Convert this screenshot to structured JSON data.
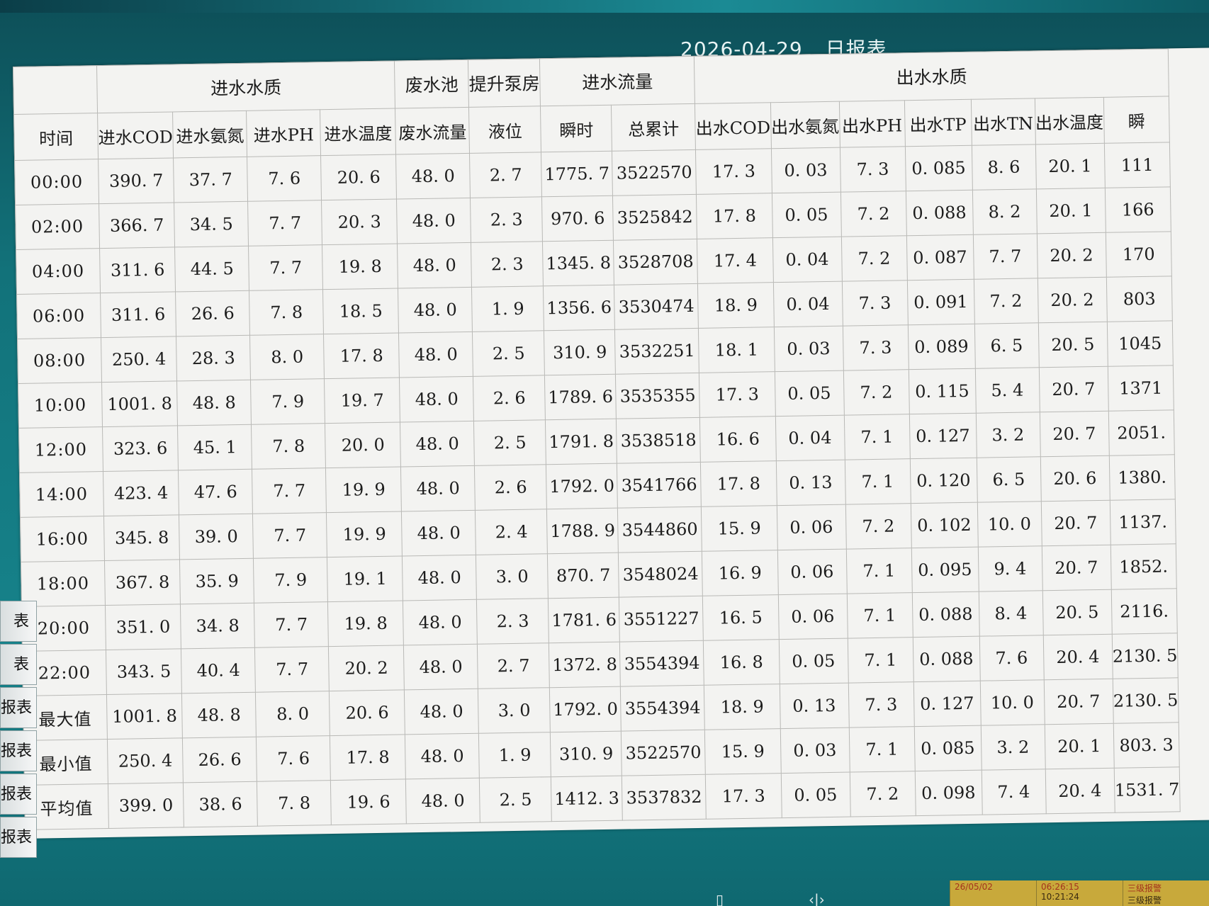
{
  "report": {
    "date": "2026-04-29",
    "title": "日报表"
  },
  "table": {
    "groups": {
      "time_blank": "",
      "inflow_quality": "进水水质",
      "waste_pool": "废水池",
      "lift_pump": "提升泵房",
      "inflow_rate": "进水流量",
      "outflow_quality": "出水水质"
    },
    "columns": [
      "时间",
      "进水COD",
      "进水氨氮",
      "进水PH",
      "进水温度",
      "废水流量",
      "液位",
      "瞬时",
      "总累计",
      "出水COD",
      "出水氨氮",
      "出水PH",
      "出水TP",
      "出水TN",
      "出水温度",
      "瞬"
    ],
    "rows": [
      [
        "00:00",
        "390. 7",
        "37. 7",
        "7. 6",
        "20. 6",
        "48. 0",
        "2. 7",
        "1775. 7",
        "3522570",
        "17. 3",
        "0. 03",
        "7. 3",
        "0. 085",
        "8. 6",
        "20. 1",
        "111"
      ],
      [
        "02:00",
        "366. 7",
        "34. 5",
        "7. 7",
        "20. 3",
        "48. 0",
        "2. 3",
        "970. 6",
        "3525842",
        "17. 8",
        "0. 05",
        "7. 2",
        "0. 088",
        "8. 2",
        "20. 1",
        "166"
      ],
      [
        "04:00",
        "311. 6",
        "44. 5",
        "7. 7",
        "19. 8",
        "48. 0",
        "2. 3",
        "1345. 8",
        "3528708",
        "17. 4",
        "0. 04",
        "7. 2",
        "0. 087",
        "7. 7",
        "20. 2",
        "170"
      ],
      [
        "06:00",
        "311. 6",
        "26. 6",
        "7. 8",
        "18. 5",
        "48. 0",
        "1. 9",
        "1356. 6",
        "3530474",
        "18. 9",
        "0. 04",
        "7. 3",
        "0. 091",
        "7. 2",
        "20. 2",
        "803"
      ],
      [
        "08:00",
        "250. 4",
        "28. 3",
        "8. 0",
        "17. 8",
        "48. 0",
        "2. 5",
        "310. 9",
        "3532251",
        "18. 1",
        "0. 03",
        "7. 3",
        "0. 089",
        "6. 5",
        "20. 5",
        "1045"
      ],
      [
        "10:00",
        "1001. 8",
        "48. 8",
        "7. 9",
        "19. 7",
        "48. 0",
        "2. 6",
        "1789. 6",
        "3535355",
        "17. 3",
        "0. 05",
        "7. 2",
        "0. 115",
        "5. 4",
        "20. 7",
        "1371"
      ],
      [
        "12:00",
        "323. 6",
        "45. 1",
        "7. 8",
        "20. 0",
        "48. 0",
        "2. 5",
        "1791. 8",
        "3538518",
        "16. 6",
        "0. 04",
        "7. 1",
        "0. 127",
        "3. 2",
        "20. 7",
        "2051."
      ],
      [
        "14:00",
        "423. 4",
        "47. 6",
        "7. 7",
        "19. 9",
        "48. 0",
        "2. 6",
        "1792. 0",
        "3541766",
        "17. 8",
        "0. 13",
        "7. 1",
        "0. 120",
        "6. 5",
        "20. 6",
        "1380."
      ],
      [
        "16:00",
        "345. 8",
        "39. 0",
        "7. 7",
        "19. 9",
        "48. 0",
        "2. 4",
        "1788. 9",
        "3544860",
        "15. 9",
        "0. 06",
        "7. 2",
        "0. 102",
        "10. 0",
        "20. 7",
        "1137."
      ],
      [
        "18:00",
        "367. 8",
        "35. 9",
        "7. 9",
        "19. 1",
        "48. 0",
        "3. 0",
        "870. 7",
        "3548024",
        "16. 9",
        "0. 06",
        "7. 1",
        "0. 095",
        "9. 4",
        "20. 7",
        "1852."
      ],
      [
        "20:00",
        "351. 0",
        "34. 8",
        "7. 7",
        "19. 8",
        "48. 0",
        "2. 3",
        "1781. 6",
        "3551227",
        "16. 5",
        "0. 06",
        "7. 1",
        "0. 088",
        "8. 4",
        "20. 5",
        "2116."
      ],
      [
        "22:00",
        "343. 5",
        "40. 4",
        "7. 7",
        "20. 2",
        "48. 0",
        "2. 7",
        "1372. 8",
        "3554394",
        "16. 8",
        "0. 05",
        "7. 1",
        "0. 088",
        "7. 6",
        "20. 4",
        "2130. 5"
      ],
      [
        "最大值",
        "1001. 8",
        "48. 8",
        "8. 0",
        "20. 6",
        "48. 0",
        "3. 0",
        "1792. 0",
        "3554394",
        "18. 9",
        "0. 13",
        "7. 3",
        "0. 127",
        "10. 0",
        "20. 7",
        "2130. 5"
      ],
      [
        "最小值",
        "250. 4",
        "26. 6",
        "7. 6",
        "17. 8",
        "48. 0",
        "1. 9",
        "310. 9",
        "3522570",
        "15. 9",
        "0. 03",
        "7. 1",
        "0. 085",
        "3. 2",
        "20. 1",
        "803. 3"
      ],
      [
        "平均值",
        "399. 0",
        "38. 6",
        "7. 8",
        "19. 6",
        "48. 0",
        "2. 5",
        "1412. 3",
        "3537832",
        "17. 3",
        "0. 05",
        "7. 2",
        "0. 098",
        "7. 4",
        "20. 4",
        "1531. 7"
      ]
    ]
  },
  "side_tabs": [
    "表",
    "表",
    "报表",
    "报表",
    "报表",
    "报表"
  ],
  "status_bar": {
    "date": "26/05/02",
    "time": "06:26:15",
    "alarm": "三级报警",
    "time2": "10:21:24",
    "alarm2": "三级报警"
  },
  "bottom_controls": [
    "▯",
    "‹|›"
  ]
}
